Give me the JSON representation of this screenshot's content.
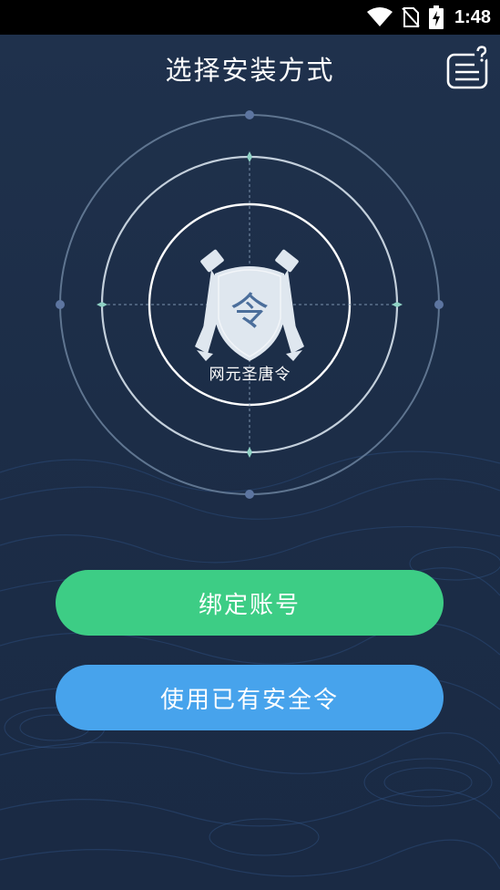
{
  "status_bar": {
    "time": "1:48",
    "icons": [
      "wifi-icon",
      "no-sim-icon",
      "battery-charging-icon"
    ]
  },
  "header": {
    "title": "选择安装方式",
    "help_icon": "help-document-icon"
  },
  "emblem": {
    "shield_glyph": "令",
    "label": "网元圣唐令"
  },
  "buttons": {
    "bind_account": "绑定账号",
    "use_existing_token": "使用已有安全令"
  },
  "colors": {
    "background": "#1c2c47",
    "bind_button": "#3dcd85",
    "existing_button": "#47a3ec",
    "shield": "#dfe7ef"
  }
}
